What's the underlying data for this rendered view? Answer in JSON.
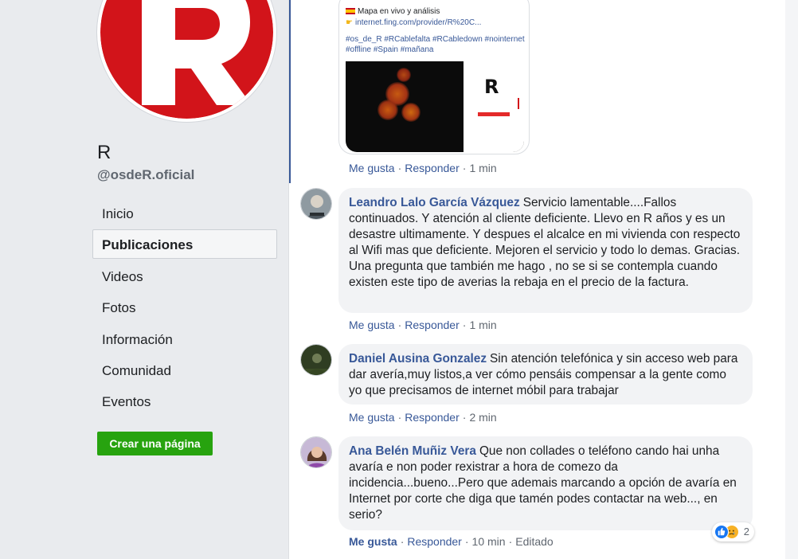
{
  "page": {
    "name": "R",
    "handle": "@osdeR.oficial",
    "avatar_logo": "R",
    "brand_red": "#d2141a"
  },
  "nav": {
    "items": [
      "Inicio",
      "Publicaciones",
      "Videos",
      "Fotos",
      "Información",
      "Comunidad",
      "Eventos"
    ],
    "active": "Publicaciones"
  },
  "create_page_button": "Crear una página",
  "post_attachment": {
    "line1": "Mapa en vivo y análisis",
    "link": "internet.fing.com/provider/R%20C...",
    "hashtags_line1": "#os_de_R #RCablefalta #RCabledown #nointernet",
    "hashtags_line2": "#offline #Spain #mañana",
    "map_logo": "R"
  },
  "post_actions": {
    "like": "Me gusta",
    "reply": "Responder",
    "time": "1 min"
  },
  "comments": [
    {
      "author": "Leandro Lalo García Vázquez",
      "text": "Servicio lamentable....Fallos continuados. Y atención al cliente deficiente. Llevo en R años y es un desastre ultimamente. Y despues el alcalce en mi vivienda con respecto al Wifi mas que deficiente. Mejoren el servicio y todo lo demas. Gracias. Una pregunta que también me hago , no se si se contempla cuando existen este tipo de averias la rebaja en el precio de la factura.",
      "like": "Me gusta",
      "reply": "Responder",
      "time": "1 min"
    },
    {
      "author": "Daniel Ausina Gonzalez",
      "text": "Sin atención telefónica y sin acceso web para dar avería,muy listos,a ver cómo pensáis compensar a la gente como yo que precisamos de internet móbil para trabajar",
      "like": "Me gusta",
      "reply": "Responder",
      "time": "2 min"
    },
    {
      "author": "Ana Belén Muñiz Vera",
      "text": "Que non collades o teléfono cando hai unha avaría e non poder rexistrar a hora de comezo da incidencia...bueno...Pero que ademais marcando a opción de avaría en Internet por corte che diga que tamén podes contactar na web..., en serio?",
      "like": "Me gusta",
      "reply": "Responder",
      "time": "10 min",
      "edited": "Editado",
      "reaction_count": "2",
      "liked": true
    }
  ]
}
